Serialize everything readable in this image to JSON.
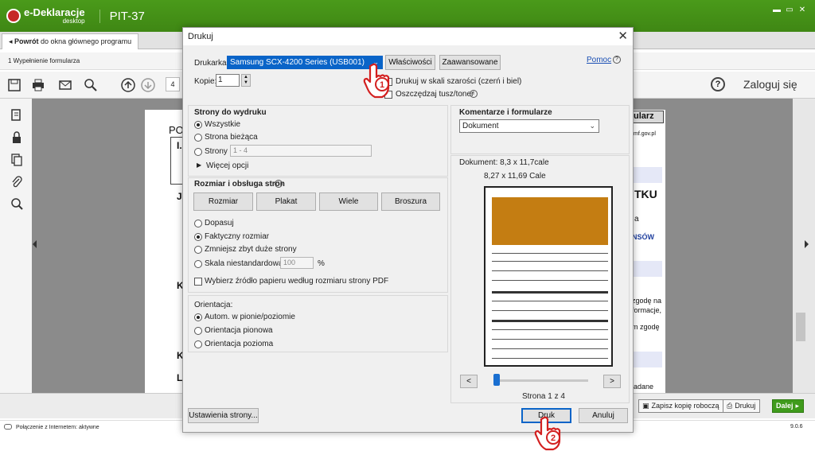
{
  "app": {
    "brand": "e-Deklaracje",
    "brand_sub": "desktop",
    "title": "PIT-37",
    "back_bold": "Powrót",
    "back_rest": "do okna głównego programu",
    "step": "1 Wypełnienie formularza",
    "page_number": "4",
    "login": "Zaloguj się",
    "help": "?",
    "status": "Połączenie z Internetem: aktywne",
    "version": "9.0.6",
    "buttons": {
      "save_draft": "Zapisz kopię roboczą",
      "print": "Drukuj",
      "next": "Dalej"
    },
    "doc_fragments": {
      "po": "PO",
      "i": "I.",
      "j": "J",
      "k": "K",
      "k2": "K",
      "l": "L",
      "ularz": "ularz",
      "email": "mf.gov.pl",
      "tku": "TKU",
      "a": "a",
      "nsow": "NSÓW",
      "zgode1": "zgodę na",
      "zgode2": "formacje,",
      "zgode3": "m zgodę",
      "dane": "ładane"
    }
  },
  "dialog": {
    "title": "Drukuj",
    "printer_label": "Drukarka:",
    "printer_value": "Samsung SCX-4200 Series (USB001)",
    "properties": "Właściwości",
    "advanced": "Zaawansowane",
    "help_link": "Pomoc",
    "copies_label": "Kopie:",
    "copies_value": "1",
    "grayscale": "Drukuj w skali szarości (czerń i biel)",
    "save_ink": "Oszczędzaj tusz/toner",
    "pages": {
      "heading": "Strony do wydruku",
      "all": "Wszystkie",
      "current": "Strona bieżąca",
      "pages": "Strony",
      "range_placeholder": "1 - 4",
      "more": "Więcej opcji"
    },
    "sizing": {
      "heading": "Rozmiar i obsługa stron",
      "tabs": [
        "Rozmiar",
        "Plakat",
        "Wiele",
        "Broszura"
      ],
      "fit": "Dopasuj",
      "actual": "Faktyczny rozmiar",
      "shrink": "Zmniejsz zbyt duże strony",
      "custom": "Skala niestandardowa:",
      "scale_value": "100",
      "percent": "%",
      "paper_source": "Wybierz źródło papieru według rozmiaru strony PDF"
    },
    "orientation": {
      "heading": "Orientacja:",
      "auto": "Autom. w pionie/poziomie",
      "portrait": "Orientacja pionowa",
      "landscape": "Orientacja pozioma"
    },
    "comments": {
      "heading": "Komentarze i formularze",
      "value": "Dokument"
    },
    "document_size": "Dokument: 8,3 x 11,7cale",
    "page_size": "8,27 x 11,69 Cale",
    "nav_prev": "<",
    "nav_next": ">",
    "page_counter": "Strona 1 z 4",
    "page_setup": "Ustawienia strony...",
    "print_btn": "Druk",
    "cancel_btn": "Anuluj",
    "annotations": [
      "1",
      "2"
    ]
  },
  "colors": {
    "green_header": "#3f8714",
    "selection": "#0a64c8",
    "preview_orange": "#c47d12"
  }
}
